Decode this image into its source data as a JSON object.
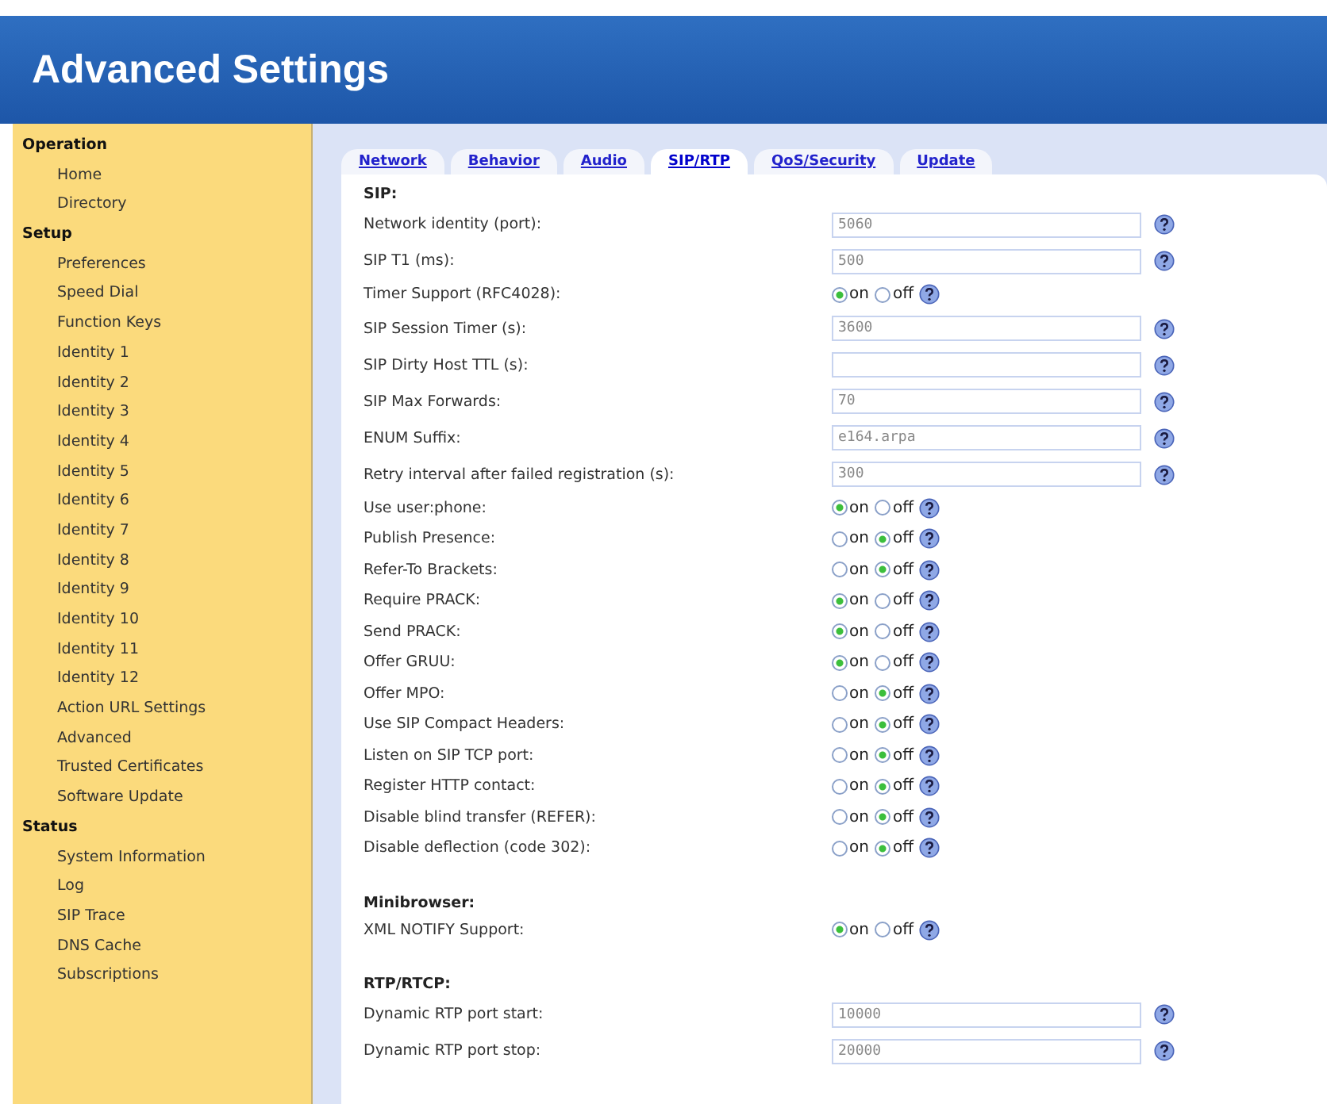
{
  "header": {
    "title": "Advanced Settings"
  },
  "sidebar": {
    "groups": [
      {
        "title": "Operation",
        "items": [
          {
            "label": "Home"
          },
          {
            "label": "Directory"
          }
        ]
      },
      {
        "title": "Setup",
        "items": [
          {
            "label": "Preferences"
          },
          {
            "label": "Speed Dial"
          },
          {
            "label": "Function Keys"
          },
          {
            "label": "Identity 1"
          },
          {
            "label": "Identity 2"
          },
          {
            "label": "Identity 3"
          },
          {
            "label": "Identity 4"
          },
          {
            "label": "Identity 5"
          },
          {
            "label": "Identity 6"
          },
          {
            "label": "Identity 7"
          },
          {
            "label": "Identity 8"
          },
          {
            "label": "Identity 9"
          },
          {
            "label": "Identity 10"
          },
          {
            "label": "Identity 11"
          },
          {
            "label": "Identity 12"
          },
          {
            "label": "Action URL Settings"
          },
          {
            "label": "Advanced"
          },
          {
            "label": "Trusted Certificates"
          },
          {
            "label": "Software Update"
          }
        ]
      },
      {
        "title": "Status",
        "items": [
          {
            "label": "System Information"
          },
          {
            "label": "Log"
          },
          {
            "label": "SIP Trace"
          },
          {
            "label": "DNS Cache"
          },
          {
            "label": "Subscriptions"
          }
        ]
      }
    ]
  },
  "tabs": [
    {
      "label": "Network",
      "selected": false
    },
    {
      "label": "Behavior",
      "selected": false
    },
    {
      "label": "Audio",
      "selected": false
    },
    {
      "label": "SIP/RTP",
      "selected": true
    },
    {
      "label": "QoS/Security",
      "selected": false
    },
    {
      "label": "Update",
      "selected": false
    }
  ],
  "sections": [
    {
      "title": "SIP:",
      "rows": [
        {
          "kind": "text",
          "label": "Network identity (port):",
          "value": "5060"
        },
        {
          "kind": "text",
          "label": "SIP T1 (ms):",
          "value": "500"
        },
        {
          "kind": "toggle",
          "label": "Timer Support (RFC4028):",
          "options": [
            {
              "label": "on",
              "selected": true
            },
            {
              "label": "off",
              "selected": false
            }
          ]
        },
        {
          "kind": "text",
          "label": "SIP Session Timer (s):",
          "value": "3600"
        },
        {
          "kind": "text",
          "label": "SIP Dirty Host TTL (s):"
        },
        {
          "kind": "text",
          "label": "SIP Max Forwards:",
          "value": "70"
        },
        {
          "kind": "text",
          "label": "ENUM Suffix:",
          "value": "e164.arpa"
        },
        {
          "kind": "text",
          "label": "Retry interval after failed registration (s):",
          "value": "300"
        },
        {
          "kind": "toggle",
          "label": "Use user:phone:",
          "options": [
            {
              "label": "on",
              "selected": true
            },
            {
              "label": "off",
              "selected": false
            }
          ]
        },
        {
          "kind": "toggle",
          "label": "Publish Presence:",
          "options": [
            {
              "label": "on",
              "selected": false
            },
            {
              "label": "off",
              "selected": true
            }
          ]
        },
        {
          "kind": "toggle",
          "label": "Refer-To Brackets:",
          "options": [
            {
              "label": "on",
              "selected": false
            },
            {
              "label": "off",
              "selected": true
            }
          ]
        },
        {
          "kind": "toggle",
          "label": "Require PRACK:",
          "options": [
            {
              "label": "on",
              "selected": true
            },
            {
              "label": "off",
              "selected": false
            }
          ]
        },
        {
          "kind": "toggle",
          "label": "Send PRACK:",
          "options": [
            {
              "label": "on",
              "selected": true
            },
            {
              "label": "off",
              "selected": false
            }
          ]
        },
        {
          "kind": "toggle",
          "label": "Offer GRUU:",
          "options": [
            {
              "label": "on",
              "selected": true
            },
            {
              "label": "off",
              "selected": false
            }
          ]
        },
        {
          "kind": "toggle",
          "label": "Offer MPO:",
          "options": [
            {
              "label": "on",
              "selected": false
            },
            {
              "label": "off",
              "selected": true
            }
          ]
        },
        {
          "kind": "toggle",
          "label": "Use SIP Compact Headers:",
          "options": [
            {
              "label": "on",
              "selected": false
            },
            {
              "label": "off",
              "selected": true
            }
          ]
        },
        {
          "kind": "toggle",
          "label": "Listen on SIP TCP port:",
          "options": [
            {
              "label": "on",
              "selected": false
            },
            {
              "label": "off",
              "selected": true
            }
          ]
        },
        {
          "kind": "toggle",
          "label": "Register HTTP contact:",
          "options": [
            {
              "label": "on",
              "selected": false
            },
            {
              "label": "off",
              "selected": true
            }
          ]
        },
        {
          "kind": "toggle",
          "label": "Disable blind transfer (REFER):",
          "options": [
            {
              "label": "on",
              "selected": false
            },
            {
              "label": "off",
              "selected": true
            }
          ]
        },
        {
          "kind": "toggle",
          "label": "Disable deflection (code 302):",
          "options": [
            {
              "label": "on",
              "selected": false
            },
            {
              "label": "off",
              "selected": true
            }
          ]
        }
      ]
    },
    {
      "title": "Minibrowser:",
      "rows": [
        {
          "kind": "toggle",
          "label": "XML NOTIFY Support:",
          "options": [
            {
              "label": "on",
              "selected": true
            },
            {
              "label": "off",
              "selected": false
            }
          ]
        }
      ]
    },
    {
      "title": "RTP/RTCP:",
      "rows": [
        {
          "kind": "text",
          "label": "Dynamic RTP port start:",
          "value": "10000"
        },
        {
          "kind": "text",
          "label": "Dynamic RTP port stop:",
          "value": "20000"
        }
      ]
    }
  ]
}
